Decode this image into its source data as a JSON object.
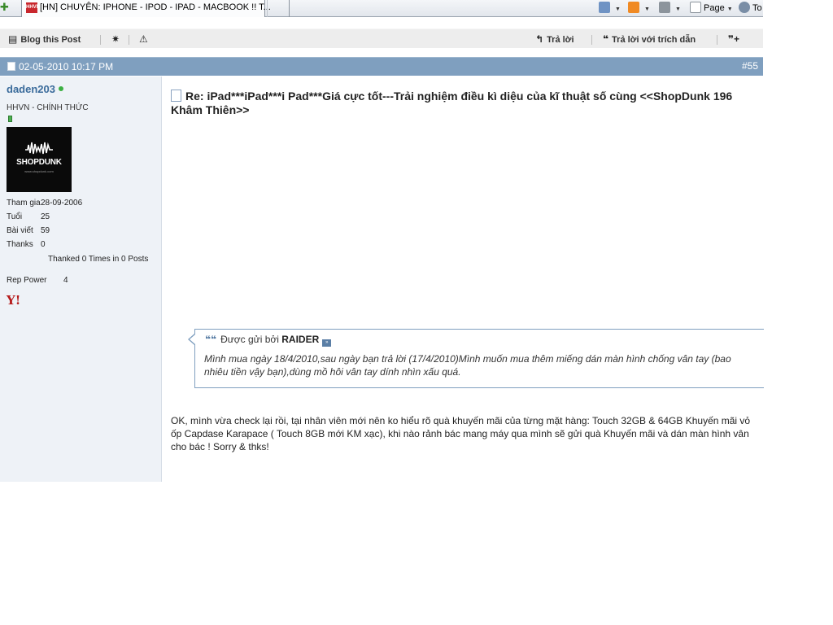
{
  "browser": {
    "tab_title": "[HN] CHUYÊN: IPHONE - IPOD - IPAD - MACBOOK !! T...",
    "tab_icon_text": "HHVN",
    "page_label": "Page",
    "tools_label": "To"
  },
  "toolbar": {
    "blog_label": "Blog this Post",
    "reply_label": "Trả lời",
    "reply_quote_label": "Trả lời với trích dẫn"
  },
  "post": {
    "date": "02-05-2010 10:17 PM",
    "number": "#55",
    "title": "Re: iPad***iPad***i Pad***Giá cực tốt---Trải nghiệm điều kì diệu của kĩ thuật số cùng <<ShopDunk 196 Khâm Thiên>>",
    "body": "OK, mình vừa check lại rồi, tại nhân viên mới nên ko hiểu rõ quà khuyến mãi của từng mặt hàng: Touch 32GB & 64GB Khuyến mãi vỏ ốp Capdase Karapace ( Touch 8GB mới KM xạc), khi nào rảnh bác mang máy qua mình sẽ gửi quà Khuyến mãi và dán màn hình vân cho bác ! Sorry & thks!"
  },
  "quote": {
    "prefix": "Được gửi bởi",
    "author": "RAIDER",
    "text": "Mình mua ngày 18/4/2010,sau ngày bạn trả lời (17/4/2010)Mình muốn mua thêm miếng dán màn hình chống vân tay (bao nhiêu tiền vậy bạn),dùng mồ hôi vân tay dính nhìn xấu quá."
  },
  "user": {
    "name": "daden203",
    "title": "HHVN - CHÍNH THỨC",
    "avatar_brand": "SHOPDUNK",
    "avatar_url": "www.shopdunk.com",
    "stats": [
      {
        "key": "Tham gia",
        "value": "28-09-2006"
      },
      {
        "key": "Tuổi",
        "value": "25"
      },
      {
        "key": "Bài viết",
        "value": "59"
      },
      {
        "key": "Thanks",
        "value": "0"
      }
    ],
    "thanked": "Thanked 0 Times in 0 Posts",
    "rep_power_label": "Rep Power",
    "rep_power_value": "4",
    "yim_icon_text": "Y!"
  },
  "colors": {
    "header_bar": "#7f9fbf",
    "sidebar_bg": "#eef2f7",
    "username": "#3a6b9b",
    "toolbar_bg": "#ededed"
  }
}
